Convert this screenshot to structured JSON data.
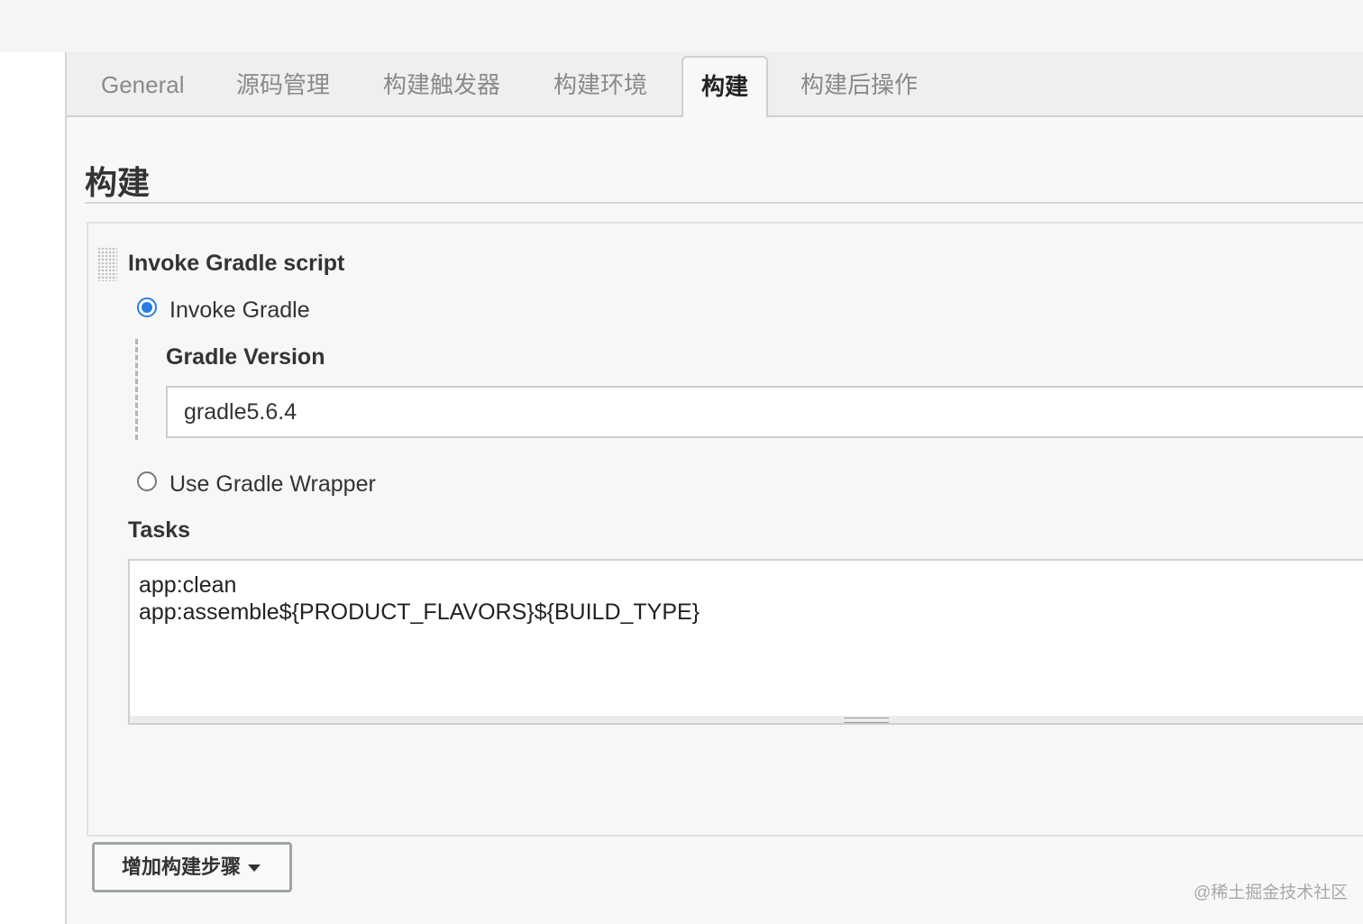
{
  "tabs": [
    {
      "label": "General",
      "active": false
    },
    {
      "label": "源码管理",
      "active": false
    },
    {
      "label": "构建触发器",
      "active": false
    },
    {
      "label": "构建环境",
      "active": false
    },
    {
      "label": "构建",
      "active": true
    },
    {
      "label": "构建后操作",
      "active": false
    }
  ],
  "section": {
    "title": "构建"
  },
  "build_step": {
    "title": "Invoke Gradle script",
    "options": [
      {
        "label": "Invoke Gradle",
        "selected": true
      },
      {
        "label": "Use Gradle Wrapper",
        "selected": false
      }
    ],
    "gradle_version": {
      "label": "Gradle Version",
      "value": "gradle5.6.4"
    },
    "tasks": {
      "label": "Tasks",
      "lines": [
        "app:clean",
        "app:assemble${PRODUCT_FLAVORS}${BUILD_TYPE}"
      ]
    }
  },
  "add_step_button": {
    "label": "增加构建步骤",
    "icon": "caret-down-icon"
  },
  "watermark": "@稀土掘金技术社区",
  "colors": {
    "accent": "#2a7de1",
    "tab_bar": "#efefef",
    "panel": "#f8f8f8"
  }
}
